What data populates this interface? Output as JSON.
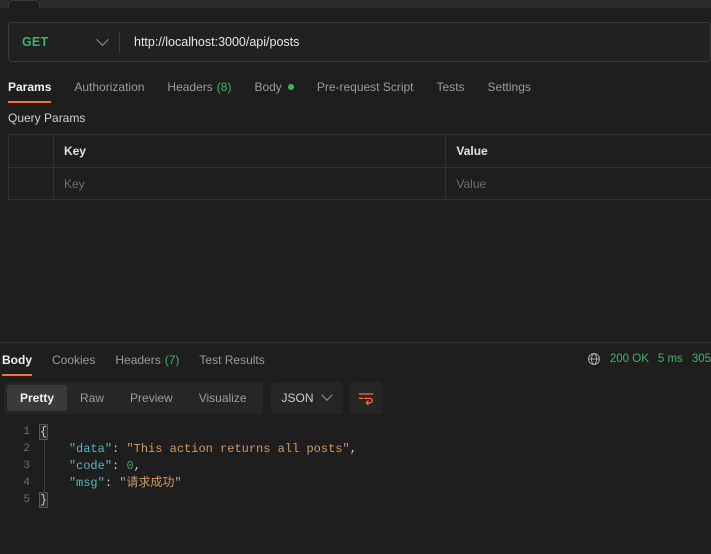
{
  "urlbar": {
    "method": "GET",
    "method_icon": "chevron-down-icon",
    "url": "http://localhost:3000/api/posts"
  },
  "request_tabs": [
    {
      "label": "Params",
      "active": true
    },
    {
      "label": "Authorization",
      "active": false
    },
    {
      "label": "Headers",
      "count": "(8)",
      "active": false
    },
    {
      "label": "Body",
      "dot": true,
      "active": false
    },
    {
      "label": "Pre-request Script",
      "active": false
    },
    {
      "label": "Tests",
      "active": false
    },
    {
      "label": "Settings",
      "active": false
    }
  ],
  "query_params": {
    "title": "Query Params",
    "columns": [
      "",
      "Key",
      "Value"
    ],
    "rows": [
      {
        "key": "Key",
        "value": "Value"
      }
    ]
  },
  "response_tabs": [
    {
      "label": "Body",
      "active": true
    },
    {
      "label": "Cookies",
      "active": false
    },
    {
      "label": "Headers",
      "count": "(7)",
      "active": false
    },
    {
      "label": "Test Results",
      "active": false
    }
  ],
  "response_meta": {
    "globe_icon": "globe-icon",
    "status": "200 OK",
    "time": "5 ms",
    "size": "305"
  },
  "format_bar": {
    "views": [
      {
        "label": "Pretty",
        "active": true
      },
      {
        "label": "Raw",
        "active": false
      },
      {
        "label": "Preview",
        "active": false
      },
      {
        "label": "Visualize",
        "active": false
      }
    ],
    "language": "JSON",
    "language_icon": "chevron-down-icon",
    "wrap_icon": "wrap-lines-icon"
  },
  "code": {
    "lines": [
      {
        "n": "1",
        "tokens": [
          {
            "t": "brace",
            "v": "{"
          }
        ]
      },
      {
        "n": "2",
        "tokens": [
          {
            "t": "plain",
            "v": "    "
          },
          {
            "t": "key",
            "v": "\"data\""
          },
          {
            "t": "punct",
            "v": ": "
          },
          {
            "t": "str",
            "v": "\"This action returns all posts\""
          },
          {
            "t": "punct",
            "v": ","
          }
        ]
      },
      {
        "n": "3",
        "tokens": [
          {
            "t": "plain",
            "v": "    "
          },
          {
            "t": "key",
            "v": "\"code\""
          },
          {
            "t": "punct",
            "v": ": "
          },
          {
            "t": "num",
            "v": "0"
          },
          {
            "t": "punct",
            "v": ","
          }
        ]
      },
      {
        "n": "4",
        "tokens": [
          {
            "t": "plain",
            "v": "    "
          },
          {
            "t": "key",
            "v": "\"msg\""
          },
          {
            "t": "punct",
            "v": ": "
          },
          {
            "t": "str",
            "v": "\"请求成功\""
          }
        ]
      },
      {
        "n": "5",
        "tokens": [
          {
            "t": "brace",
            "v": "}"
          }
        ]
      }
    ]
  },
  "colors": {
    "accent": "#ff6c37",
    "success": "#3eb36b",
    "background": "#1e1e1e",
    "panel": "#262626",
    "border": "#333333"
  }
}
